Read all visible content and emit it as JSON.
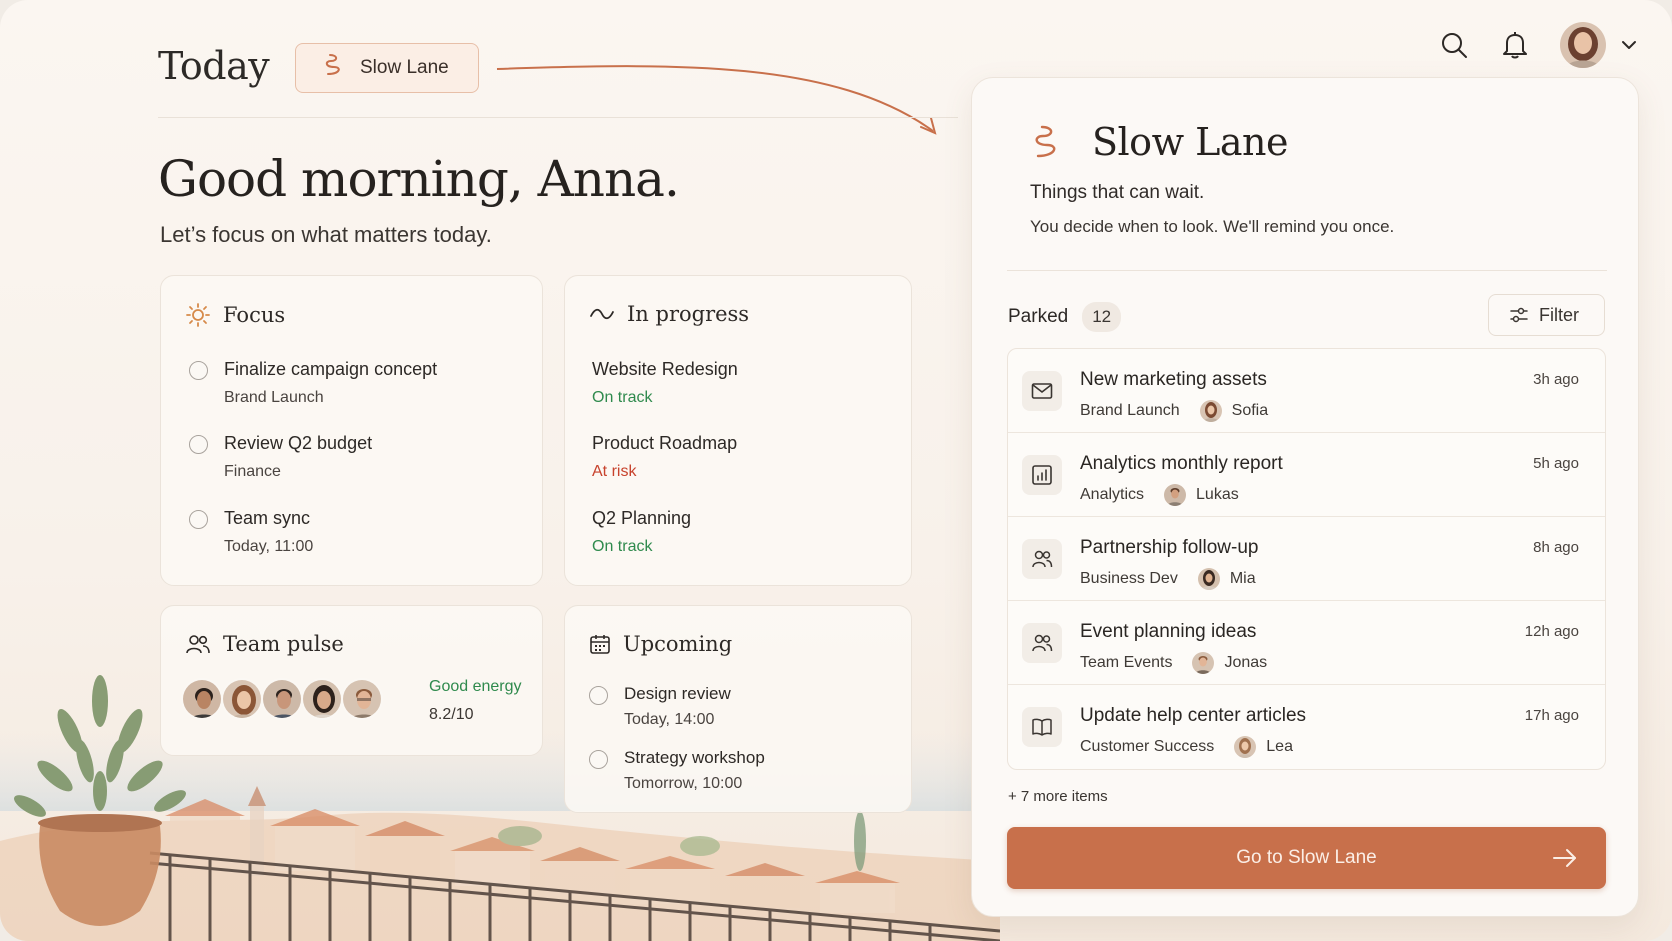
{
  "app": {
    "page_title": "Today",
    "slow_lane_chip_label": "Slow Lane",
    "accent_color": "#c8704b"
  },
  "topbar": {
    "icons": [
      "search-icon",
      "bell-icon",
      "avatar",
      "chevron-down-icon"
    ]
  },
  "hero": {
    "greeting": "Good morning, Anna.",
    "subtitle": "Let’s focus on what matters today."
  },
  "focus": {
    "title": "Focus",
    "icon": "sun-icon",
    "tasks": [
      {
        "title": "Finalize campaign concept",
        "sub": "Brand Launch"
      },
      {
        "title": "Review Q2 budget",
        "sub": "Finance"
      },
      {
        "title": "Team sync",
        "sub": "Today, 11:00"
      }
    ]
  },
  "in_progress": {
    "title": "In progress",
    "icon": "trend-icon",
    "projects": [
      {
        "name": "Website Redesign",
        "status": "On track",
        "status_color": "#2f8a4d"
      },
      {
        "name": "Product Roadmap",
        "status": "At risk",
        "status_color": "#c7422c"
      },
      {
        "name": "Q2 Planning",
        "status": "On track",
        "status_color": "#2f8a4d"
      }
    ]
  },
  "team_pulse": {
    "title": "Team pulse",
    "icon": "people-icon",
    "energy_label": "Good energy",
    "score": "8.2/10"
  },
  "upcoming": {
    "title": "Upcoming",
    "icon": "calendar-icon",
    "events": [
      {
        "title": "Design review",
        "time": "Today, 14:00"
      },
      {
        "title": "Strategy workshop",
        "time": "Tomorrow, 10:00"
      }
    ]
  },
  "slow_lane": {
    "title": "Slow Lane",
    "subtitle": "Things that can wait.",
    "description": "You decide when to look. We'll remind you once.",
    "parked_label": "Parked",
    "parked_count": "12",
    "filter_label": "Filter",
    "items": [
      {
        "title": "New marketing assets",
        "team": "Brand Launch",
        "person": "Sofia",
        "time": "3h ago",
        "icon": "mail-icon"
      },
      {
        "title": "Analytics monthly report",
        "team": "Analytics",
        "person": "Lukas",
        "time": "5h ago",
        "icon": "chart-icon"
      },
      {
        "title": "Partnership follow-up",
        "team": "Business Dev",
        "person": "Mia",
        "time": "8h ago",
        "icon": "people-icon"
      },
      {
        "title": "Event planning ideas",
        "team": "Team Events",
        "person": "Jonas",
        "time": "12h ago",
        "icon": "people-icon"
      },
      {
        "title": "Update help center articles",
        "team": "Customer Success",
        "person": "Lea",
        "time": "17h ago",
        "icon": "book-icon"
      }
    ],
    "more_label": "+ 7 more items",
    "cta_label": "Go to Slow Lane"
  }
}
